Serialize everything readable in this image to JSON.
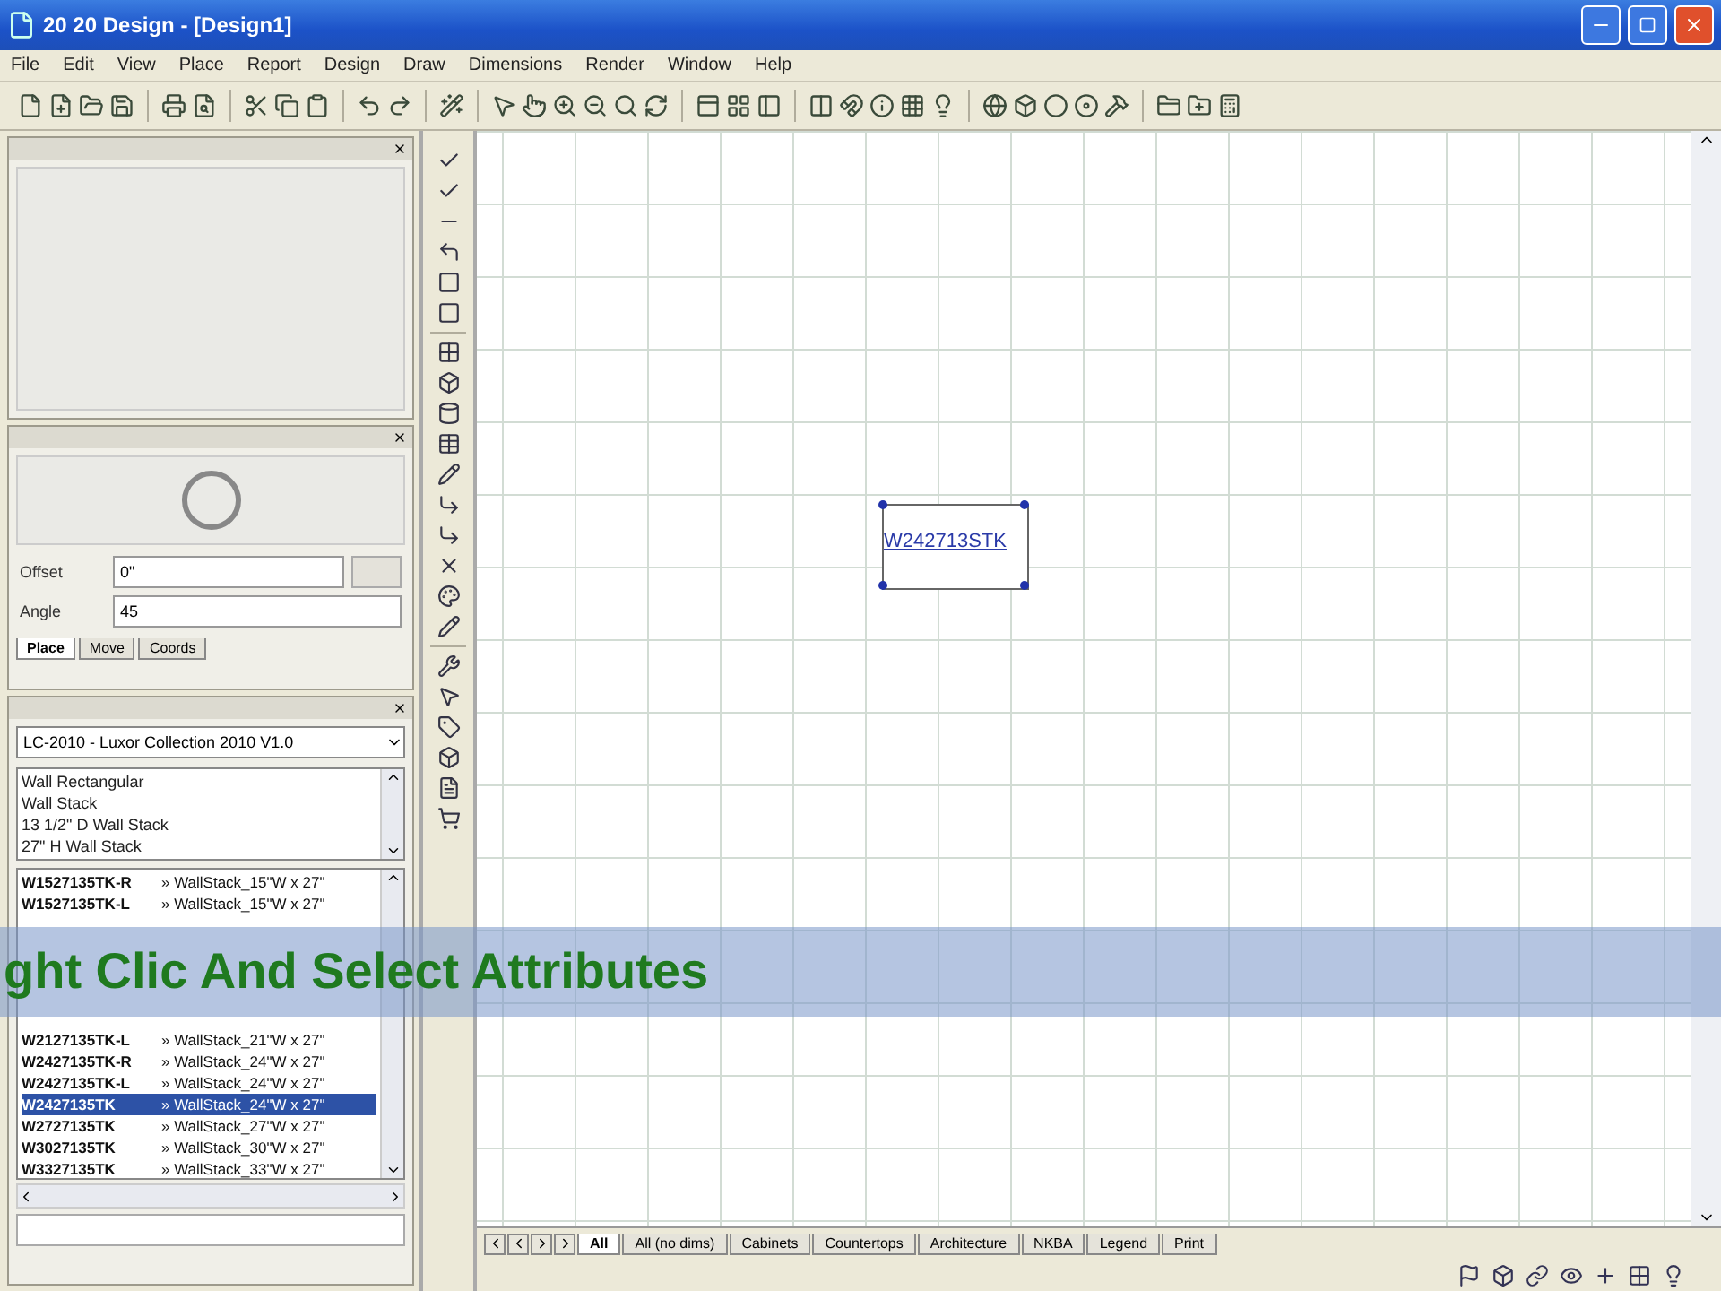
{
  "window": {
    "title": "20 20 Design - [Design1]"
  },
  "menu": [
    "File",
    "Edit",
    "View",
    "Place",
    "Report",
    "Design",
    "Draw",
    "Dimensions",
    "Render",
    "Window",
    "Help"
  ],
  "place_panel": {
    "offset_label": "Offset",
    "offset_value": "0\"",
    "angle_label": "Angle",
    "angle_value": "45",
    "tabs": [
      {
        "label": "Place",
        "selected": true
      },
      {
        "label": "Move",
        "selected": false
      },
      {
        "label": "Coords",
        "selected": false
      }
    ]
  },
  "catalog_panel": {
    "catalog": "LC-2010 - Luxor Collection 2010 V1.0",
    "categories": [
      "Wall Rectangular",
      "Wall Stack",
      "13 1/2\" D Wall Stack",
      "27\" H Wall Stack"
    ],
    "items_top": [
      {
        "code": "W1527135TK-R",
        "description": "» WallStack_15\"W x 27\"",
        "selected": false
      },
      {
        "code": "W1527135TK-L",
        "description": "» WallStack_15\"W x 27\"",
        "selected": false
      }
    ],
    "items_bottom": [
      {
        "code": "W2127135TK-L",
        "description": "» WallStack_21\"W x 27\"",
        "selected": false
      },
      {
        "code": "W2427135TK-R",
        "description": "» WallStack_24\"W x 27\"",
        "selected": false
      },
      {
        "code": "W2427135TK-L",
        "description": "» WallStack_24\"W x 27\"",
        "selected": false
      },
      {
        "code": "W2427135TK",
        "description": "» WallStack_24\"W x 27\"",
        "selected": true
      },
      {
        "code": "W2727135TK",
        "description": "» WallStack_27\"W x 27\"",
        "selected": false
      },
      {
        "code": "W3027135TK",
        "description": "» WallStack_30\"W x 27\"",
        "selected": false
      },
      {
        "code": "W3327135TK",
        "description": "» WallStack_33\"W x 27\"",
        "selected": false
      }
    ]
  },
  "canvas": {
    "object_label": "W242713STK"
  },
  "view_tabs": [
    {
      "label": "All",
      "selected": true
    },
    {
      "label": "All (no dims)",
      "selected": false
    },
    {
      "label": "Cabinets",
      "selected": false
    },
    {
      "label": "Countertops",
      "selected": false
    },
    {
      "label": "Architecture",
      "selected": false
    },
    {
      "label": "NKBA",
      "selected": false
    },
    {
      "label": "Legend",
      "selected": false
    },
    {
      "label": "Print",
      "selected": false
    }
  ],
  "caption": "ght Clic And Select Attributes"
}
